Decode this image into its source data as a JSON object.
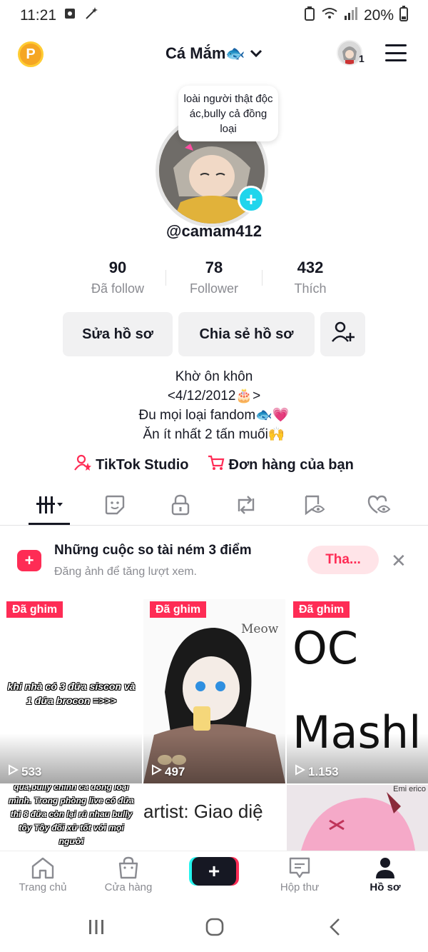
{
  "status": {
    "time": "11:21",
    "battery": "20%"
  },
  "header": {
    "coin": "P",
    "username": "Cá Mắm🐟",
    "notification_count": "1"
  },
  "profile": {
    "note": "loài người thật độc ác,bully cả đồng loại",
    "handle": "@camam412",
    "stats": [
      {
        "value": "90",
        "label": "Đã follow"
      },
      {
        "value": "78",
        "label": "Follower"
      },
      {
        "value": "432",
        "label": "Thích"
      }
    ],
    "buttons": {
      "edit": "Sửa hồ sơ",
      "share": "Chia sẻ hồ sơ"
    },
    "bio": [
      "Khờ ôn khôn",
      "<4/12/2012🎂>",
      "Đu mọi loại fandom🐟💗",
      "Ăn ít nhất 2 tấn muối🙌"
    ],
    "links": {
      "studio": "TikTok Studio",
      "orders": "Đơn hàng của bạn"
    }
  },
  "promo": {
    "title": "Những cuộc so tài ném 3 điểm",
    "subtitle": "Đăng ảnh để tăng lượt xem.",
    "button": "Tha..."
  },
  "videos": [
    {
      "pinned": "Đã ghim",
      "views": "533",
      "caption": "khi nhà có 3 đứa siscon và 1 đứa brocon =>>>"
    },
    {
      "pinned": "Đã ghim",
      "views": "497",
      "caption": "Meow"
    },
    {
      "pinned": "Đã ghim",
      "views": "1.153",
      "caption": "OC Mashle"
    }
  ],
  "videos_row2": [
    {
      "caption": "qua,bully chính cả đồng loại mình. Trong phòng live có đứa thì 8 đứa còn lại rủ nhau bully tôy Tôy đối xử tốt với mọi người"
    },
    {
      "caption": "artist: Giao diệ"
    },
    {
      "caption": "Emi erico"
    }
  ],
  "nav": {
    "home": "Trang chủ",
    "shop": "Cửa hàng",
    "create": "+",
    "inbox": "Hộp thư",
    "profile": "Hồ sơ"
  },
  "colors": {
    "accent": "#fe2c55",
    "cyan": "#20d5ec",
    "muted": "#8a8b91"
  }
}
